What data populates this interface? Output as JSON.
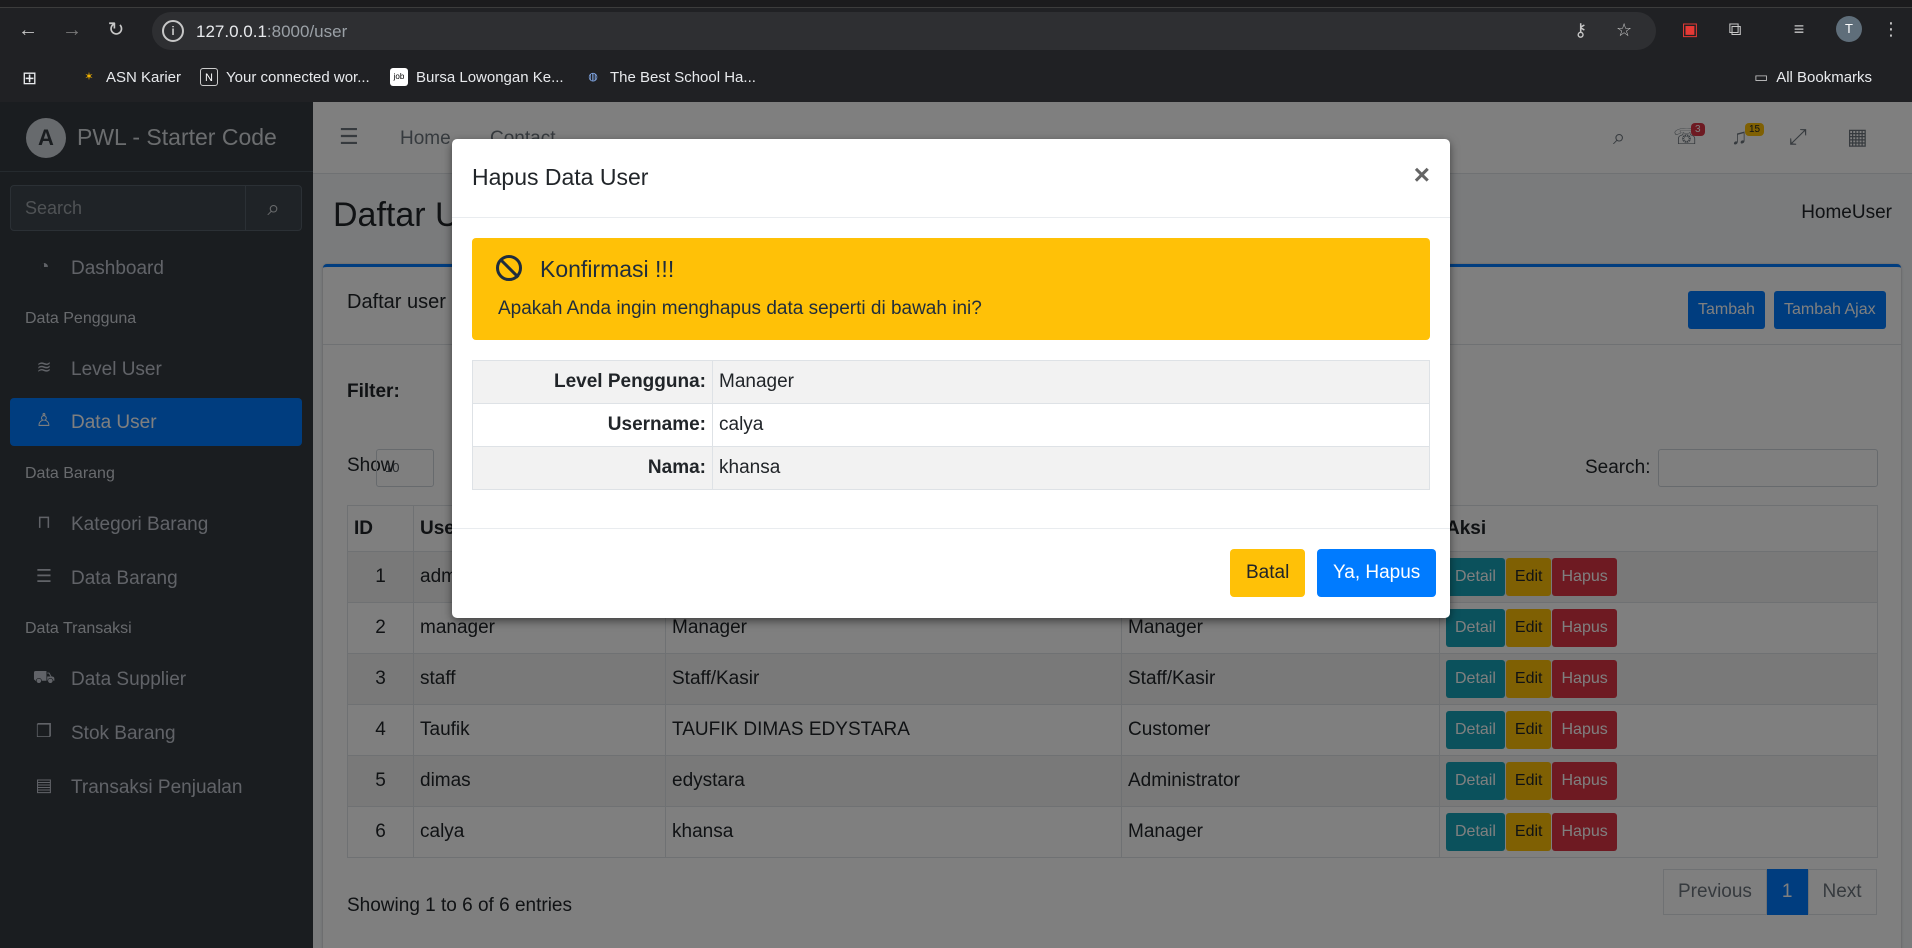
{
  "browser": {
    "url_host": "127.0.0.1",
    "url_rest": ":8000/user",
    "profile_initial": "T",
    "bookmarks": [
      {
        "label": "ASN Karier",
        "icon": "asn-icon"
      },
      {
        "label": "Your connected wor...",
        "icon": "notion-icon"
      },
      {
        "label": "Bursa Lowongan Ke...",
        "icon": "jobs-icon"
      },
      {
        "label": "The Best School Ha...",
        "icon": "globe-icon"
      }
    ],
    "all_bookmarks": "All Bookmarks"
  },
  "sidebar": {
    "brand": "PWL - Starter Code",
    "search_placeholder": "Search",
    "items": {
      "dashboard": "Dashboard",
      "level_user": "Level User",
      "data_user": "Data User",
      "kategori": "Kategori Barang",
      "data_barang": "Data Barang",
      "supplier": "Data Supplier",
      "stok": "Stok Barang",
      "transaksi": "Transaksi Penjualan"
    },
    "headers": {
      "pengguna": "Data Pengguna",
      "barang": "Data Barang",
      "transaksi": "Data Transaksi"
    }
  },
  "topnav": {
    "home": "Home",
    "contact": "Contact",
    "messages_badge": "3",
    "notifications_badge": "15"
  },
  "page": {
    "title": "Daftar U",
    "breadcrumb": "HomeUser",
    "card_title": "Daftar user",
    "btn_tambah": "Tambah",
    "btn_tambah_ajax": "Tambah Ajax",
    "filter": "Filter:",
    "show": "Show",
    "show_value": "10",
    "search_label": "Search:",
    "table_headers": [
      "ID",
      "Use",
      "",
      "",
      "Aksi"
    ],
    "rows": [
      [
        "1",
        "adm",
        "",
        ""
      ],
      [
        "2",
        "manager",
        "Manager",
        "Manager"
      ],
      [
        "3",
        "staff",
        "Staff/Kasir",
        "Staff/Kasir"
      ],
      [
        "4",
        "Taufik",
        "TAUFIK DIMAS EDYSTARA",
        "Customer"
      ],
      [
        "5",
        "dimas",
        "edystara",
        "Administrator"
      ],
      [
        "6",
        "calya",
        "khansa",
        "Manager"
      ]
    ],
    "action_labels": {
      "detail": "Detail",
      "edit": "Edit",
      "hapus": "Hapus"
    },
    "showing": "Showing 1 to 6 of 6 entries",
    "pager": {
      "prev": "Previous",
      "page": "1",
      "next": "Next"
    }
  },
  "modal": {
    "title": "Hapus Data User",
    "close": "×",
    "alert_heading": "Konfirmasi !!!",
    "alert_text": "Apakah Anda ingin menghapus data seperti di bawah ini?",
    "fields": [
      {
        "label": "Level Pengguna:",
        "value": "Manager"
      },
      {
        "label": "Username:",
        "value": "calya"
      },
      {
        "label": "Nama:",
        "value": "khansa"
      }
    ],
    "btn_cancel": "Batal",
    "btn_confirm": "Ya, Hapus"
  },
  "colors": {
    "primary": "#007bff",
    "warning": "#ffc107",
    "danger": "#dc3545",
    "info": "#17a2b8",
    "sidebar": "#343a40"
  }
}
